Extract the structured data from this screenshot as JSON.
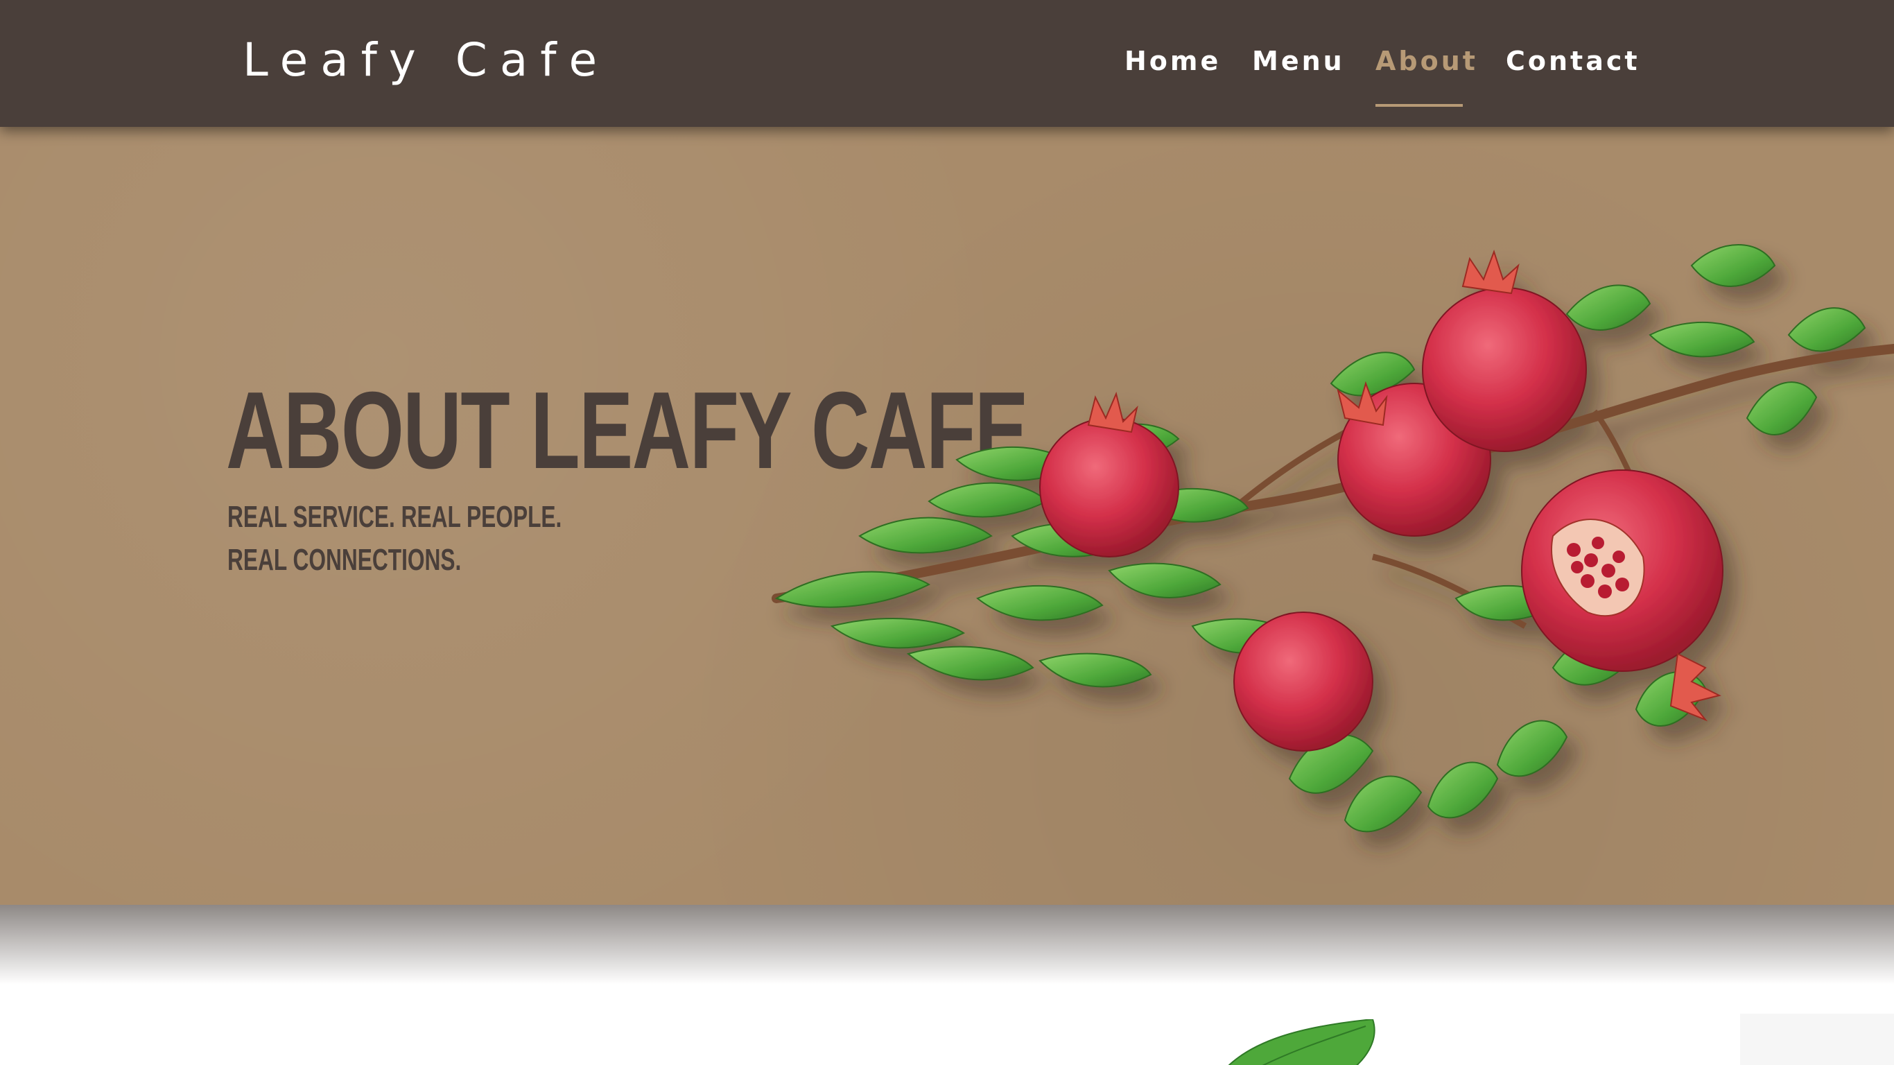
{
  "header": {
    "logo": "Leafy Cafe",
    "nav": [
      {
        "label": "Home",
        "active": false
      },
      {
        "label": "Menu",
        "active": false
      },
      {
        "label": "About",
        "active": true
      },
      {
        "label": "Contact",
        "active": false
      }
    ]
  },
  "hero": {
    "title": "ABOUT LEAFY CAFE",
    "subtitle_line1": "REAL SERVICE. REAL PEOPLE.",
    "subtitle_line2": "REAL CONNECTIONS.",
    "image_subject": "pomegranate-branch-illustration"
  },
  "colors": {
    "header_bg": "#4a3f3a",
    "nav_text": "#ffffff",
    "nav_active": "#b79a76",
    "hero_bg": "#a88b6a",
    "hero_text": "#4a3f3a",
    "leaf_green": "#4ea83a",
    "fruit_red": "#c8283a"
  }
}
